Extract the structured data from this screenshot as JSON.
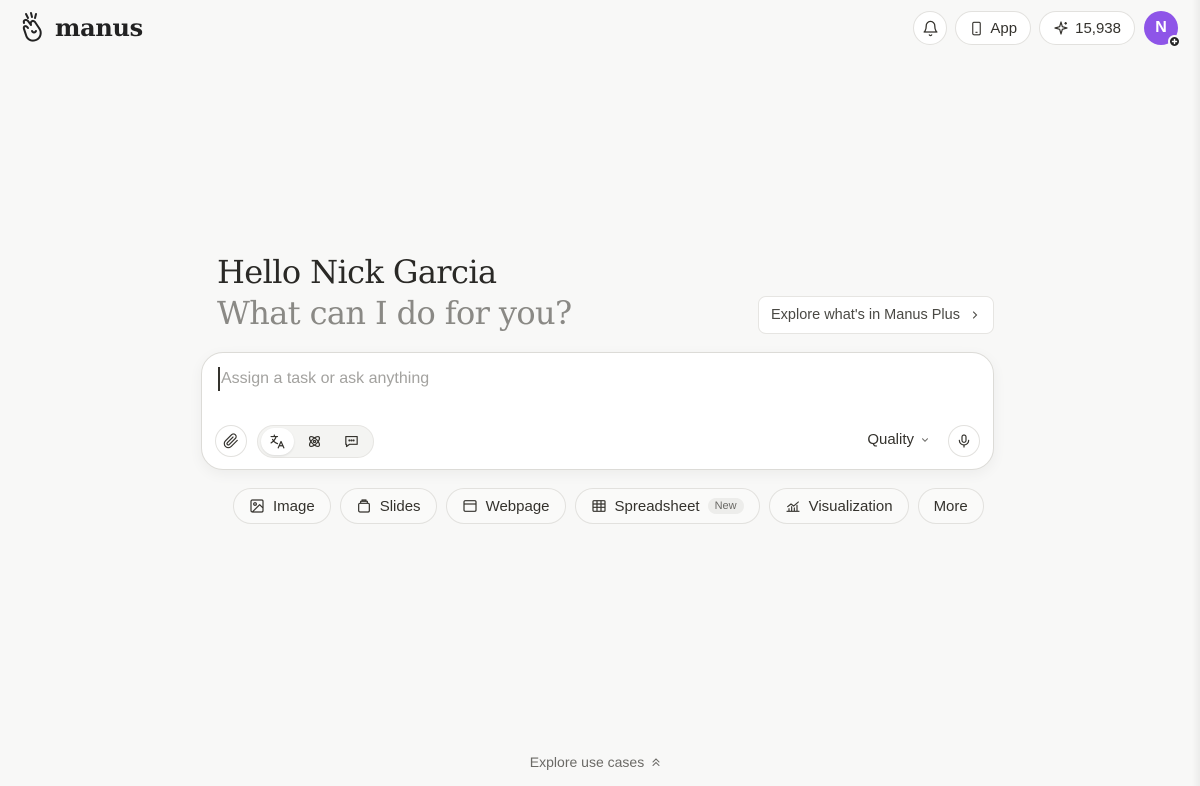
{
  "brand": {
    "name": "manus"
  },
  "header": {
    "app_label": "App",
    "credits": "15,938",
    "avatar_initial": "N"
  },
  "greeting": {
    "line1": "Hello Nick Garcia",
    "line2": "What can I do for you?"
  },
  "promo": {
    "label": "Explore what's in Manus Plus"
  },
  "composer": {
    "placeholder": "Assign a task or ask anything",
    "quality_label": "Quality"
  },
  "chips": {
    "image": "Image",
    "slides": "Slides",
    "webpage": "Webpage",
    "spreadsheet": "Spreadsheet",
    "spreadsheet_badge": "New",
    "visualization": "Visualization",
    "more": "More"
  },
  "footer": {
    "explore_label": "Explore use cases"
  }
}
